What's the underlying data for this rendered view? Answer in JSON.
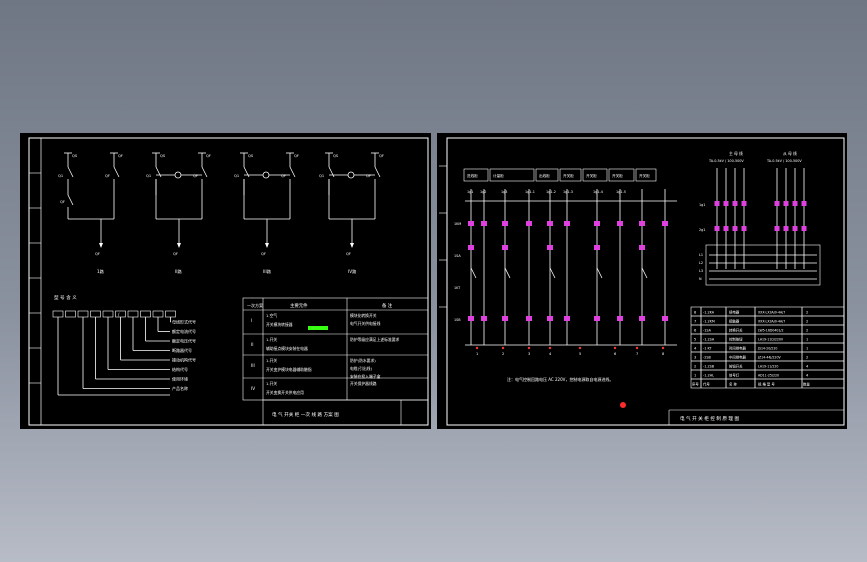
{
  "left_sheet": {
    "circuits": [
      {
        "sw_a": "QS",
        "sw_b": "QF",
        "feeder": "I",
        "node": "1路",
        "lbl_a": "Q1",
        "lbl_b": "QF",
        "tag": "QF"
      },
      {
        "sw_a": "QS",
        "sw_b": "QF",
        "feeder": "II",
        "node": "II路",
        "lbl_a": "Q1",
        "lbl_b": "QF",
        "tag": "QF"
      },
      {
        "sw_a": "QS",
        "sw_b": "QF",
        "feeder": "III",
        "node": "III路",
        "lbl_a": "Q1",
        "lbl_b": "QF",
        "tag": "QF"
      },
      {
        "sw_a": "QS",
        "sw_b": "QF",
        "feeder": "IV",
        "node": "IV路",
        "lbl_a": "Q1",
        "lbl_b": "QF",
        "tag": "QF"
      }
    ],
    "code_title": "型 号 含 义",
    "code_items": [
      "母线形式代号",
      "额定电流代号",
      "额定电压代号",
      "断路器代号",
      "操动机构代号",
      "结构代号",
      "使用环境",
      "产品名称"
    ],
    "table_headers": [
      "一次方案",
      "主要元件",
      "备 注"
    ],
    "table_rows": [
      {
        "id": "I",
        "items": [
          "1.空气",
          "开关模块转接器"
        ],
        "note": [
          "模块化转换开关",
          "电气开关供电接线"
        ]
      },
      {
        "id": "II",
        "items": [
          "1.开关",
          "辅助接点模块安装在电器"
        ],
        "note": [
          "防护等级应满足上述标准要求"
        ]
      },
      {
        "id": "III",
        "items": [
          "1.开关",
          "开关变护模块电器辅助触指"
        ],
        "note": [
          "防护(防水要求)",
          "电缆(引出线)",
          "安装在投入端子盒"
        ]
      },
      {
        "id": "IV",
        "items": [
          "1.开关",
          "开关变换开关供电应用"
        ],
        "note": [
          "开关保护器线路"
        ]
      }
    ],
    "title_block": "电 气 开关 柜 一次 线 路 方案 图"
  },
  "right_sheet": {
    "header_cells": [
      "进线柜",
      "计量柜",
      "出线柜",
      "开关柜",
      "开关柜",
      "开关柜",
      "开关柜"
    ],
    "sub_labels": [
      "1g1",
      "1g2",
      "1g3",
      "1g1-1",
      "1g1-2",
      "1g1-3",
      "1g1-4",
      "1g1-5"
    ],
    "wire_labels": [
      "1KM",
      "1SA",
      "1KT",
      "1SB"
    ],
    "node_numbers": [
      "1",
      "2",
      "3",
      "4",
      "5",
      "6",
      "7",
      "8"
    ],
    "bus_titles": [
      "主 母 线",
      "从 母 线"
    ],
    "bus_spec": [
      "TA-0.5kV / 100-500V",
      "TA-0.5kV / 100-500V"
    ],
    "bus_row_labels": [
      "1g1",
      "2g1",
      "L1",
      "L2",
      "L3",
      "N"
    ],
    "note": "注：电气控制回路电压 AC 220V，控制电源取自电源进线。",
    "parts": [
      {
        "n": "8",
        "code": "-1.2KA",
        "name": "续电器",
        "model": "XXX-LX3A/0-4A/7",
        "qty": "2"
      },
      {
        "n": "7",
        "code": "-1.2KM",
        "name": "接触器",
        "model": "XXX-LX3A/0-4A/7",
        "qty": "2"
      },
      {
        "n": "6",
        "code": "-1SA",
        "name": "转换开关",
        "model": "LW5-16D0401/2",
        "qty": "2"
      },
      {
        "n": "5",
        "code": "-1.2SA",
        "name": "控制按钮",
        "model": "LA19-11D/220V",
        "qty": "1"
      },
      {
        "n": "4",
        "code": "-1 KT",
        "name": "时间继电器",
        "model": "JS14-20/220",
        "qty": "1"
      },
      {
        "n": "3",
        "code": "-2SB",
        "name": "中间继电器",
        "model": "JZ14-44J/220V",
        "qty": "2"
      },
      {
        "n": "2",
        "code": "-1.2SB",
        "name": "按钮开关",
        "model": "LA19-11/220",
        "qty": "4"
      },
      {
        "n": "1",
        "code": "-1.2HL",
        "name": "信号灯",
        "model": "AD11-25/220",
        "qty": "4"
      }
    ],
    "parts_header": [
      "序号",
      "代号",
      "名 称",
      "规 格 型 号",
      "数量"
    ],
    "title_block": "电 气 开 关 柜 控 制 原 理 图"
  }
}
